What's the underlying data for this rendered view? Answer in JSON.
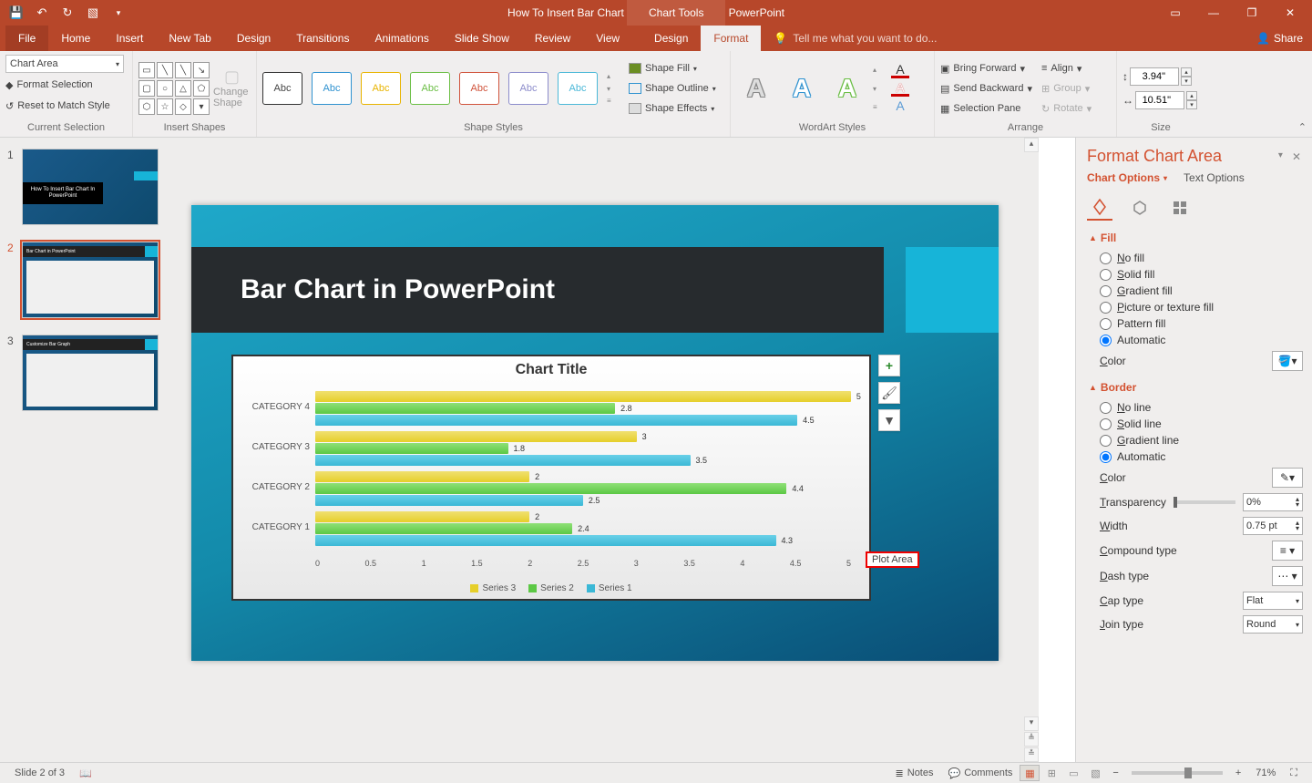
{
  "titlebar": {
    "doc_title": "How To Insert Bar Chart In PowerPoint.pptx - PowerPoint",
    "contextual_tab": "Chart Tools"
  },
  "tabs": {
    "file": "File",
    "home": "Home",
    "insert": "Insert",
    "newtab": "New Tab",
    "design": "Design",
    "transitions": "Transitions",
    "animations": "Animations",
    "slideshow": "Slide Show",
    "review": "Review",
    "view": "View",
    "chart_design": "Design",
    "format": "Format",
    "tellme": "Tell me what you want to do...",
    "share": "Share"
  },
  "ribbon": {
    "current_selection": {
      "label": "Current Selection",
      "combo": "Chart Area",
      "format_selection": "Format Selection",
      "reset": "Reset to Match Style"
    },
    "insert_shapes": {
      "label": "Insert Shapes",
      "change_shape": "Change Shape"
    },
    "shape_styles": {
      "label": "Shape Styles",
      "swatch_text": "Abc",
      "shape_fill": "Shape Fill",
      "shape_outline": "Shape Outline",
      "shape_effects": "Shape Effects"
    },
    "wordart": {
      "label": "WordArt Styles"
    },
    "arrange": {
      "label": "Arrange",
      "bring_forward": "Bring Forward",
      "send_backward": "Send Backward",
      "selection_pane": "Selection Pane",
      "align": "Align",
      "group": "Group",
      "rotate": "Rotate"
    },
    "size": {
      "label": "Size",
      "height": "3.94\"",
      "width": "10.51\""
    }
  },
  "thumbs": {
    "1": "How To Insert Bar Chart In PowerPoint",
    "2": "Bar Chart in PowerPoint",
    "3": "Customize Bar Graph"
  },
  "slide": {
    "title": "Bar Chart in PowerPoint",
    "chart_title": "Chart Title",
    "plot_area_tip": "Plot Area"
  },
  "chart_data": {
    "type": "bar",
    "orientation": "horizontal",
    "title": "Chart Title",
    "categories": [
      "CATEGORY 1",
      "CATEGORY 2",
      "CATEGORY 3",
      "CATEGORY 4"
    ],
    "series": [
      {
        "name": "Series 1",
        "values": [
          4.3,
          2.5,
          3.5,
          4.5
        ]
      },
      {
        "name": "Series 2",
        "values": [
          2.4,
          4.4,
          1.8,
          2.8
        ]
      },
      {
        "name": "Series 3",
        "values": [
          2.0,
          2.0,
          3.0,
          5.0
        ]
      }
    ],
    "xlim": [
      0,
      5
    ],
    "x_ticks": [
      "0",
      "0.5",
      "1",
      "1.5",
      "2",
      "2.5",
      "3",
      "3.5",
      "4",
      "4.5",
      "5"
    ],
    "legend_position": "bottom",
    "legend": [
      "Series 3",
      "Series 2",
      "Series 1"
    ]
  },
  "chart_buttons": {
    "elements": "+",
    "styles_brush": "🖌",
    "filter": "⧩"
  },
  "pane": {
    "title": "Format Chart Area",
    "tab_chart_options": "Chart Options",
    "tab_text_options": "Text Options",
    "fill": {
      "heading": "Fill",
      "no_fill": "No fill",
      "solid": "Solid fill",
      "gradient": "Gradient fill",
      "picture": "Picture or texture fill",
      "pattern": "Pattern fill",
      "automatic": "Automatic",
      "color": "Color"
    },
    "border": {
      "heading": "Border",
      "no_line": "No line",
      "solid": "Solid line",
      "gradient": "Gradient line",
      "automatic": "Automatic",
      "color": "Color",
      "transparency": "Transparency",
      "transparency_val": "0%",
      "width": "Width",
      "width_val": "0.75 pt",
      "compound": "Compound type",
      "dash": "Dash type",
      "cap": "Cap type",
      "cap_val": "Flat",
      "join": "Join type",
      "join_val": "Round"
    }
  },
  "status": {
    "slide_info": "Slide 2 of 3",
    "notes": "Notes",
    "comments": "Comments",
    "zoom": "71%"
  }
}
